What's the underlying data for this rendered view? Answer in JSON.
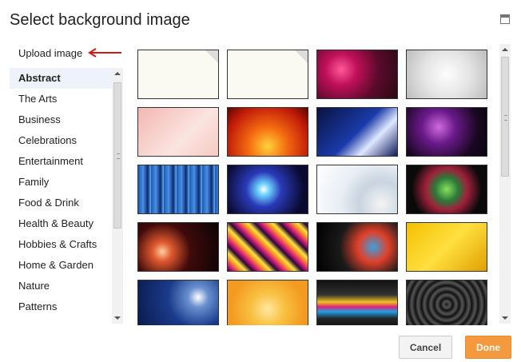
{
  "dialog": {
    "title": "Select background image",
    "upload_label": "Upload image",
    "categories": [
      "Abstract",
      "The Arts",
      "Business",
      "Celebrations",
      "Entertainment",
      "Family",
      "Food & Drink",
      "Health & Beauty",
      "Hobbies & Crafts",
      "Home & Garden",
      "Nature",
      "Patterns"
    ],
    "selected_category": "Abstract",
    "cancel_label": "Cancel",
    "done_label": "Done",
    "accent_color": "#f4993d",
    "arrow_color": "#d11a1a"
  }
}
